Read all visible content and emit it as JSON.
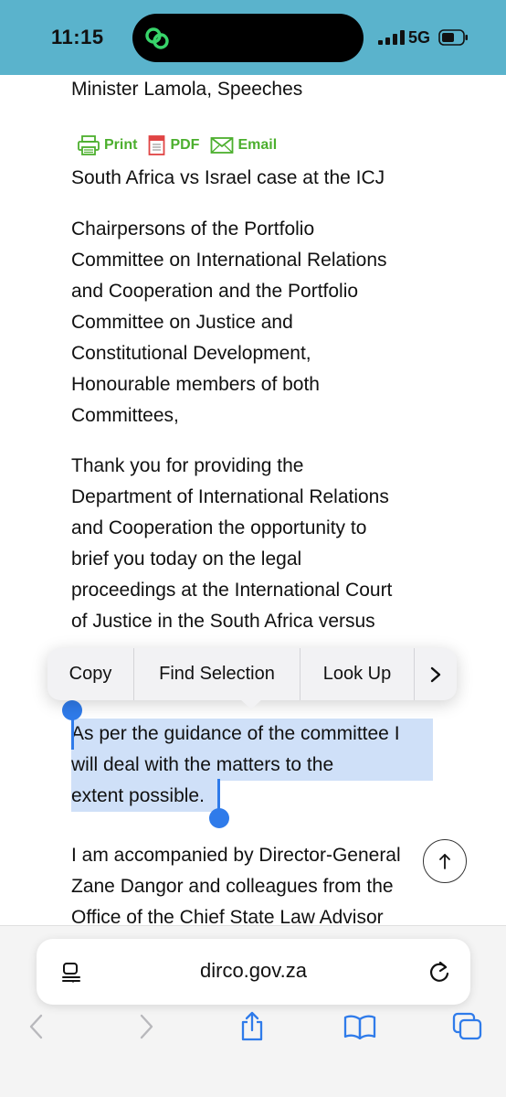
{
  "status": {
    "time": "11:15",
    "network": "5G"
  },
  "article": {
    "breadcrumb": "Minister Lamola, Speeches",
    "share": {
      "print": "Print",
      "pdf": "PDF",
      "email": "Email"
    },
    "title": "South Africa vs Israel case at the ICJ",
    "para1_lines": [
      "Chairpersons of the Portfolio",
      "Committee on International Relations",
      "and Cooperation and the Portfolio",
      "Committee on Justice and",
      "Constitutional Development,",
      "Honourable members of both",
      "Committees,"
    ],
    "para2_lines": [
      "Thank you for providing the",
      "Department of International Relations",
      "and Cooperation the opportunity to",
      "brief you today on the legal",
      "proceedings at the International Court",
      "of Justice in the South Africa versus"
    ],
    "selected_lines": [
      "As per the guidance of the committee I",
      "will deal with the matters to the",
      "extent possible."
    ],
    "para4_lines": [
      "I am accompanied by Director-General",
      "Zane Dangor and colleagues from the",
      "Office of the Chief State Law Advisor"
    ]
  },
  "context_menu": {
    "items": [
      "Copy",
      "Find Selection",
      "Look Up"
    ],
    "more": ">"
  },
  "browser": {
    "url": "dirco.gov.za"
  },
  "colors": {
    "status_bar": "#5ab3cc",
    "link_green": "#4caf2e",
    "selection": "#cfe0f8",
    "handle": "#2f7bea",
    "toolbar_icon": "#2f7bea"
  }
}
